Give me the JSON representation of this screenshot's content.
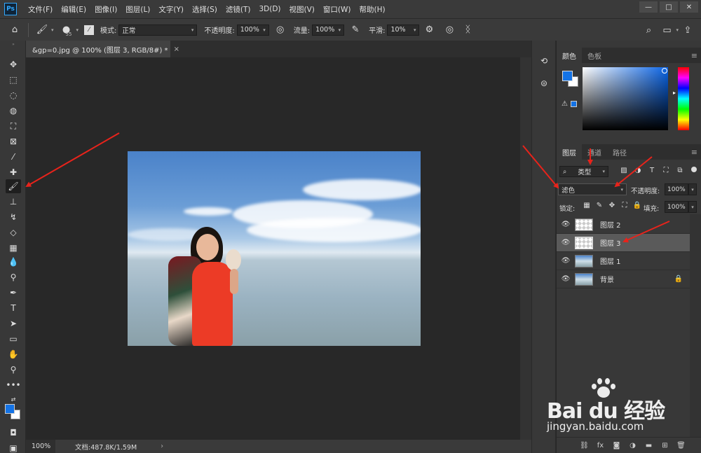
{
  "app": {
    "logo": "Ps",
    "menu": [
      "文件(F)",
      "编辑(E)",
      "图像(I)",
      "图层(L)",
      "文字(Y)",
      "选择(S)",
      "滤镜(T)",
      "3D(D)",
      "视图(V)",
      "窗口(W)",
      "帮助(H)"
    ],
    "window_controls": [
      "—",
      "□",
      "✕"
    ]
  },
  "options": {
    "brush_size": "55",
    "mode_label": "模式:",
    "mode_value": "正常",
    "opacity_label": "不透明度:",
    "opacity_value": "100%",
    "flow_label": "流量:",
    "flow_value": "100%",
    "smooth_label": "平滑:",
    "smooth_value": "10%"
  },
  "document": {
    "tab_title": "&gp=0.jpg @ 100% (图层 3, RGB/8#) *",
    "tab_close": "×",
    "zoom": "100%",
    "doc_info": "文档:487.8K/1.59M",
    "status_arrow": "›"
  },
  "color_panel": {
    "tabs": [
      "颜色",
      "色板"
    ],
    "fg_color": "#1473e6",
    "bg_color": "#ffffff"
  },
  "layers_panel": {
    "tabs": [
      "图层",
      "通道",
      "路径"
    ],
    "filter_value": "类型",
    "blend_mode": "滤色",
    "opacity_label": "不透明度:",
    "opacity_value": "100%",
    "lock_label": "锁定:",
    "fill_label": "填充:",
    "fill_value": "100%",
    "layers": [
      {
        "name": "图层 2",
        "selected": false,
        "thumb": "transparent",
        "locked": false
      },
      {
        "name": "图层 3",
        "selected": true,
        "thumb": "transparent",
        "locked": false
      },
      {
        "name": "图层 1",
        "selected": false,
        "thumb": "photo",
        "locked": false
      },
      {
        "name": "背景",
        "selected": false,
        "thumb": "photo",
        "locked": true
      }
    ]
  },
  "watermark": {
    "brand": "Bai du 经验",
    "url": "jingyan.baidu.com"
  },
  "annotation_color": "#e8231b"
}
